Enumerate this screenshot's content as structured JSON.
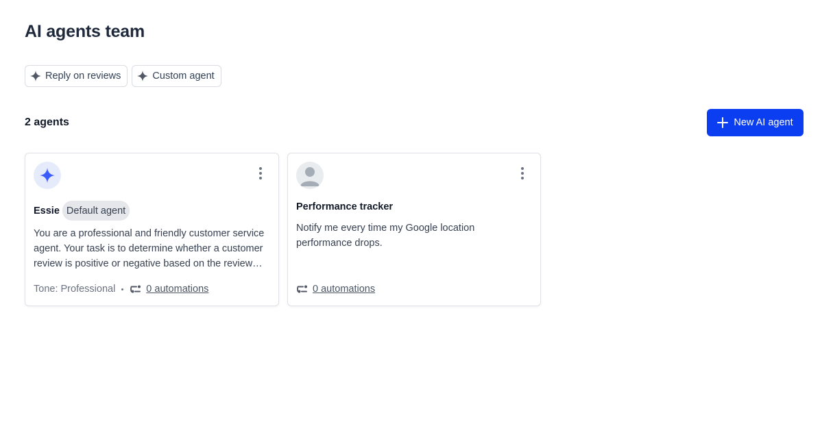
{
  "page": {
    "title": "AI agents team"
  },
  "templates": [
    {
      "label": "Reply on reviews",
      "icon": "sparkle-icon"
    },
    {
      "label": "Custom agent",
      "icon": "sparkle-icon"
    }
  ],
  "agents_header": {
    "count_label": "2 agents",
    "new_button_label": "New AI agent"
  },
  "agents": [
    {
      "name": "Essie",
      "badge": "Default agent",
      "avatar_icon": "sparkle-icon",
      "description": "You are a professional and friendly customer service agent. Your task is to determine whether a customer review is positive or negative based on the review content and rating.",
      "tone": "Tone: Professional",
      "automations": "0 automations"
    },
    {
      "name": "Performance tracker",
      "avatar_icon": "person-icon",
      "description": "Notify me every time my Google location performance drops.",
      "automations": "0 automations"
    }
  ],
  "colors": {
    "accent": "#0b3ef0",
    "sparkle": "#3b5bfd",
    "muted": "#6b7280"
  }
}
